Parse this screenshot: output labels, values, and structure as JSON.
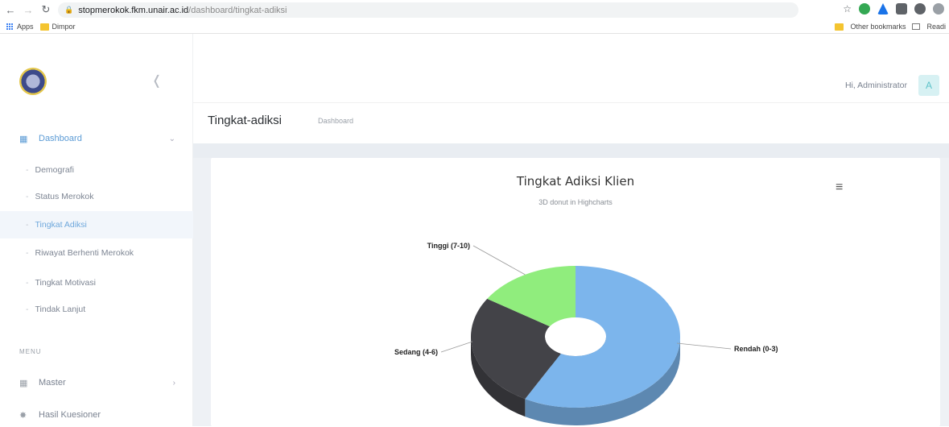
{
  "browser": {
    "url_domain": "stopmerokok.fkm.unair.ac.id",
    "url_path": "/dashboard/tingkat-adiksi",
    "bookmarks": [
      "Apps",
      "Dimpor"
    ],
    "bookmarks_right": [
      "Other bookmarks",
      "Readi"
    ]
  },
  "header": {
    "greeting": "Hi, Administrator",
    "avatar_letter": "A"
  },
  "sidebar": {
    "dashboard_label": "Dashboard",
    "sub_items": [
      "Demografi",
      "Status Merokok",
      "Tingkat Adiksi",
      "Riwayat Berhenti Merokok",
      "Tingkat Motivasi",
      "Tindak Lanjut"
    ],
    "menu_title": "MENU",
    "master_label": "Master",
    "hasil_label": "Hasil Kuesioner"
  },
  "page": {
    "title": "Tingkat-adiksi",
    "breadcrumb": "Dashboard"
  },
  "chart_data": {
    "type": "pie",
    "title": "Tingkat Adiksi Klien",
    "subtitle": "3D donut in Highcharts",
    "categories": [
      "Rendah (0-3)",
      "Sedang (4-6)",
      "Tinggi (7-10)"
    ],
    "values": [
      58,
      26,
      16
    ],
    "colors": [
      "#7cb5ec",
      "#434348",
      "#90ed7d"
    ]
  }
}
